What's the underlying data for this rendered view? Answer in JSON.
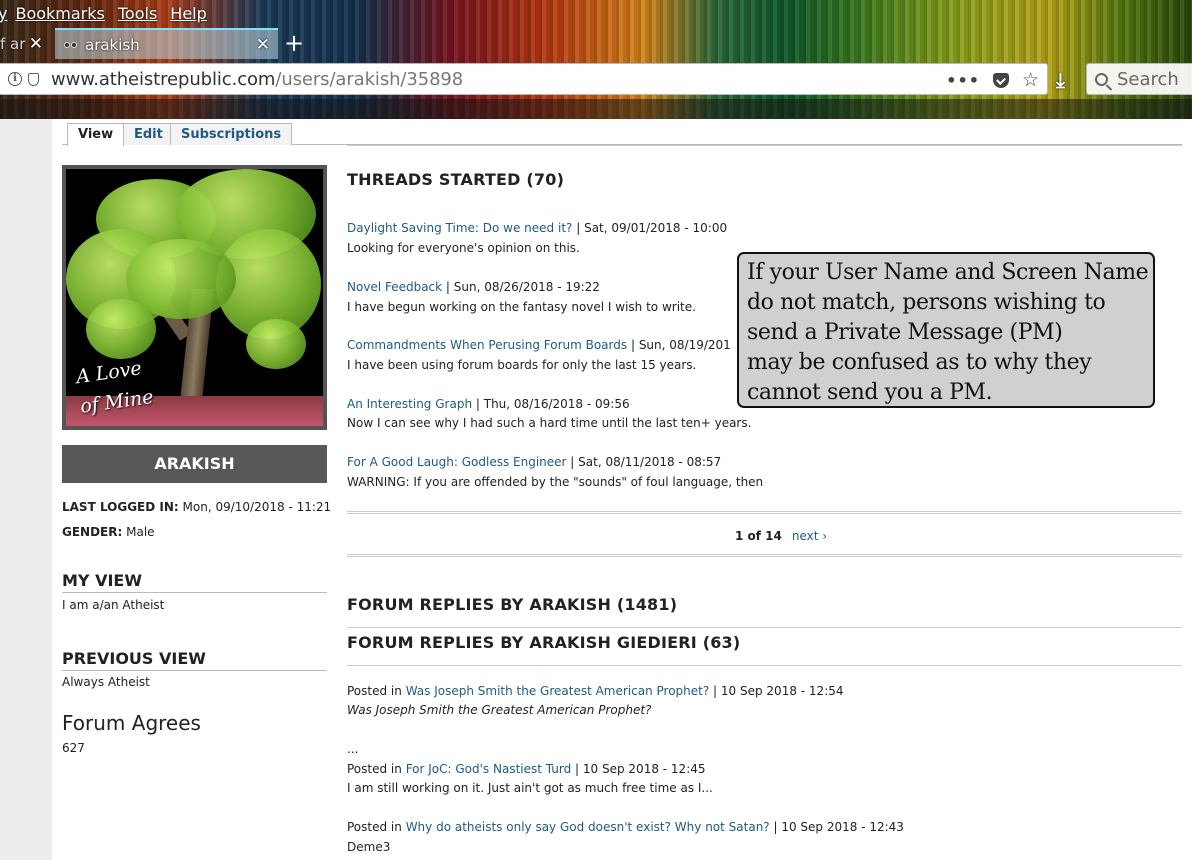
{
  "browser": {
    "menu": [
      "y",
      "Bookmarks",
      "Tools",
      "Help"
    ],
    "tabs": [
      {
        "title": "f ar",
        "active": false
      },
      {
        "title": "arakish",
        "active": true
      }
    ],
    "url_host": "www.atheistrepublic.com",
    "url_path": "/users/arakish/35898",
    "search_placeholder": "Search"
  },
  "page_tabs": [
    "View",
    "Edit",
    "Subscriptions"
  ],
  "profile": {
    "avatar_text_line1": "A Love",
    "avatar_text_line2": "of Mine",
    "username": "ARAKISH",
    "last_logged_label": "LAST LOGGED IN:",
    "last_logged_value": "Mon, 09/10/2018 - 11:21",
    "gender_label": "GENDER:",
    "gender_value": "Male",
    "my_view_title": "MY VIEW",
    "my_view_text": "I am a/an Atheist",
    "previous_view_title": "PREVIOUS VIEW",
    "previous_view_text": "Always Atheist",
    "forum_agrees_title": "Forum Agrees",
    "forum_agrees_value": "627"
  },
  "threads": {
    "title": "THREADS STARTED (70)",
    "items": [
      {
        "title": "Daylight Saving Time: Do we need it?",
        "date": " | Sat, 09/01/2018 - 10:00",
        "excerpt": "Looking for everyone's opinion on this."
      },
      {
        "title": "Novel Feedback",
        "date": " | Sun, 08/26/2018 - 19:22",
        "excerpt": "I have begun working on the fantasy novel I wish to write."
      },
      {
        "title": "Commandments When Perusing Forum Boards",
        "date": " | Sun, 08/19/201",
        "excerpt": "I have been using forum boards for only the last 15 years."
      },
      {
        "title": "An Interesting Graph",
        "date": " | Thu, 08/16/2018 - 09:56",
        "excerpt": "Now I can see why I had such a hard time until the last ten+ years."
      },
      {
        "title": "For A Good Laugh: Godless Engineer",
        "date": " | Sat, 08/11/2018 - 08:57",
        "excerpt": "WARNING: If you are offended by the \"sounds\" of foul language, then"
      }
    ],
    "pager_current": "1 of 14",
    "pager_next": "next ›"
  },
  "replies": {
    "title1": "FORUM REPLIES BY ARAKISH (1481)",
    "title2": "FORUM REPLIES BY ARAKISH GIEDIERI (63)",
    "items": [
      {
        "prefix": "Posted in ",
        "title": "Was Joseph Smith the Greatest American Prophet?",
        "date": " | 10 Sep 2018 - 12:54",
        "excerpt": "Was Joseph Smith the Greatest American Prophet?",
        "extra": "..."
      },
      {
        "prefix": "Posted in ",
        "title": "For JoC: God's Nastiest Turd",
        "date": " | 10 Sep 2018 - 12:45",
        "excerpt": "I am still working on it. Just ain't got as much free time as I..."
      },
      {
        "prefix": "Posted in ",
        "title": "Why do atheists only say God doesn't exist? Why not Satan?",
        "date": " | 10 Sep 2018 - 12:43",
        "excerpt": "Deme3"
      }
    ]
  },
  "callout_lines": [
    "If your User Name and Screen Name",
    "do not match, persons wishing to",
    "send a Private Message (PM)",
    "may be confused as to why they",
    "cannot send you a PM."
  ]
}
